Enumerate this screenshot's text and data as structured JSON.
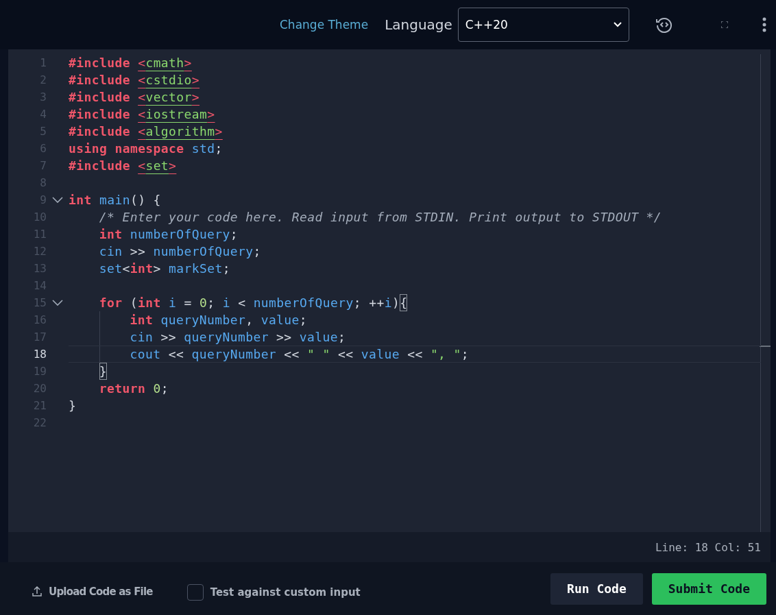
{
  "toolbar": {
    "theme_link": "Change Theme",
    "language_label": "Language",
    "language_select": {
      "value": "C++20"
    }
  },
  "editor": {
    "lines": [
      {
        "number": "1",
        "fold": false,
        "selected": false,
        "tokens": [
          {
            "kind": "keyword",
            "text": "#include "
          },
          {
            "kind": "bracket",
            "text": "<"
          },
          {
            "kind": "header",
            "text": "cmath"
          },
          {
            "kind": "bracket",
            "text": ">"
          }
        ]
      },
      {
        "number": "2",
        "fold": false,
        "selected": false,
        "tokens": [
          {
            "kind": "keyword",
            "text": "#include "
          },
          {
            "kind": "bracket",
            "text": "<"
          },
          {
            "kind": "header",
            "text": "cstdio"
          },
          {
            "kind": "bracket",
            "text": ">"
          }
        ]
      },
      {
        "number": "3",
        "fold": false,
        "selected": false,
        "tokens": [
          {
            "kind": "keyword",
            "text": "#include "
          },
          {
            "kind": "bracket",
            "text": "<"
          },
          {
            "kind": "header",
            "text": "vector"
          },
          {
            "kind": "bracket",
            "text": ">"
          }
        ]
      },
      {
        "number": "4",
        "fold": false,
        "selected": false,
        "tokens": [
          {
            "kind": "keyword",
            "text": "#include "
          },
          {
            "kind": "bracket",
            "text": "<"
          },
          {
            "kind": "header",
            "text": "iostream"
          },
          {
            "kind": "bracket",
            "text": ">"
          }
        ]
      },
      {
        "number": "5",
        "fold": false,
        "selected": false,
        "tokens": [
          {
            "kind": "keyword",
            "text": "#include "
          },
          {
            "kind": "bracket",
            "text": "<"
          },
          {
            "kind": "header",
            "text": "algorithm"
          },
          {
            "kind": "bracket",
            "text": ">"
          }
        ]
      },
      {
        "number": "6",
        "fold": false,
        "selected": false,
        "tokens": [
          {
            "kind": "keyword",
            "text": "using namespace "
          },
          {
            "kind": "ident",
            "text": "std"
          },
          {
            "kind": "plain",
            "text": ";"
          }
        ]
      },
      {
        "number": "7",
        "fold": false,
        "selected": false,
        "tokens": [
          {
            "kind": "keyword",
            "text": "#include "
          },
          {
            "kind": "bracket",
            "text": "<"
          },
          {
            "kind": "header",
            "text": "set"
          },
          {
            "kind": "bracket",
            "text": ">"
          }
        ]
      },
      {
        "number": "8",
        "fold": false,
        "selected": false
      },
      {
        "number": "9",
        "fold": true,
        "selected": false,
        "tokens": [
          {
            "kind": "keyword",
            "text": "int "
          },
          {
            "kind": "ident",
            "text": "main"
          },
          {
            "kind": "plain",
            "text": "() {"
          }
        ]
      },
      {
        "number": "10",
        "fold": false,
        "selected": false,
        "tokens": [
          {
            "kind": "comment",
            "text": "    /* Enter your code here. Read input from STDIN. Print output to STDOUT */"
          }
        ]
      },
      {
        "number": "11",
        "fold": false,
        "selected": false,
        "tokens": [
          {
            "kind": "keyword",
            "text": "    int "
          },
          {
            "kind": "ident",
            "text": "numberOfQuery"
          },
          {
            "kind": "plain",
            "text": ";"
          }
        ]
      },
      {
        "number": "12",
        "fold": false,
        "selected": false,
        "tokens": [
          {
            "kind": "ident",
            "text": "    cin"
          },
          {
            "kind": "plain",
            "text": " >> "
          },
          {
            "kind": "ident",
            "text": "numberOfQuery"
          },
          {
            "kind": "plain",
            "text": ";"
          }
        ]
      },
      {
        "number": "13",
        "fold": false,
        "selected": false,
        "tokens": [
          {
            "kind": "ident",
            "text": "    set"
          },
          {
            "kind": "plain",
            "text": "<"
          },
          {
            "kind": "keyword",
            "text": "int"
          },
          {
            "kind": "plain",
            "text": "> "
          },
          {
            "kind": "ident",
            "text": "markSet"
          },
          {
            "kind": "plain",
            "text": ";"
          }
        ]
      },
      {
        "number": "14",
        "fold": false,
        "selected": false
      },
      {
        "number": "15",
        "fold": true,
        "selected": false,
        "tokens": [
          {
            "kind": "keyword",
            "text": "    for"
          },
          {
            "kind": "plain",
            "text": " ("
          },
          {
            "kind": "keyword",
            "text": "int "
          },
          {
            "kind": "ident",
            "text": "i"
          },
          {
            "kind": "plain",
            "text": " = "
          },
          {
            "kind": "number",
            "text": "0"
          },
          {
            "kind": "plain",
            "text": "; "
          },
          {
            "kind": "ident",
            "text": "i"
          },
          {
            "kind": "plain",
            "text": " < "
          },
          {
            "kind": "ident",
            "text": "numberOfQuery"
          },
          {
            "kind": "plain",
            "text": "; ++"
          },
          {
            "kind": "ident",
            "text": "i"
          },
          {
            "kind": "plain",
            "text": ")"
          },
          {
            "kind": "match",
            "text": "{"
          }
        ]
      },
      {
        "number": "16",
        "fold": false,
        "selected": false,
        "tokens": [
          {
            "kind": "keyword",
            "text": "        int "
          },
          {
            "kind": "ident",
            "text": "queryNumber"
          },
          {
            "kind": "plain",
            "text": ", "
          },
          {
            "kind": "ident",
            "text": "value"
          },
          {
            "kind": "plain",
            "text": ";"
          }
        ]
      },
      {
        "number": "17",
        "fold": false,
        "selected": false,
        "tokens": [
          {
            "kind": "ident",
            "text": "        cin"
          },
          {
            "kind": "plain",
            "text": " >> "
          },
          {
            "kind": "ident",
            "text": "queryNumber"
          },
          {
            "kind": "plain",
            "text": " >> "
          },
          {
            "kind": "ident",
            "text": "value"
          },
          {
            "kind": "plain",
            "text": ";"
          }
        ]
      },
      {
        "number": "18",
        "fold": false,
        "selected": true,
        "tokens": [
          {
            "kind": "ident",
            "text": "        cout"
          },
          {
            "kind": "plain",
            "text": " << "
          },
          {
            "kind": "ident",
            "text": "queryNumber"
          },
          {
            "kind": "plain",
            "text": " << "
          },
          {
            "kind": "string",
            "text": "\" \""
          },
          {
            "kind": "plain",
            "text": " << "
          },
          {
            "kind": "ident",
            "text": "value"
          },
          {
            "kind": "plain",
            "text": " << "
          },
          {
            "kind": "string",
            "text": "\", \""
          },
          {
            "kind": "plain",
            "text": ";"
          }
        ]
      },
      {
        "number": "19",
        "fold": false,
        "selected": false,
        "tokens": [
          {
            "kind": "match",
            "text": "    }"
          }
        ]
      },
      {
        "number": "20",
        "fold": false,
        "selected": false,
        "tokens": [
          {
            "kind": "keyword",
            "text": "    return "
          },
          {
            "kind": "number",
            "text": "0"
          },
          {
            "kind": "plain",
            "text": ";"
          }
        ]
      },
      {
        "number": "21",
        "fold": false,
        "selected": false,
        "tokens": [
          {
            "kind": "plain",
            "text": "}"
          }
        ]
      },
      {
        "number": "22",
        "fold": false,
        "selected": false
      }
    ],
    "status": "Line: 18 Col: 51"
  },
  "footer": {
    "upload": "Upload Code as File",
    "custom_input": {
      "label": "Test against custom input",
      "checked": false
    },
    "run_button": "Run Code",
    "submit_button": "Submit Code"
  }
}
